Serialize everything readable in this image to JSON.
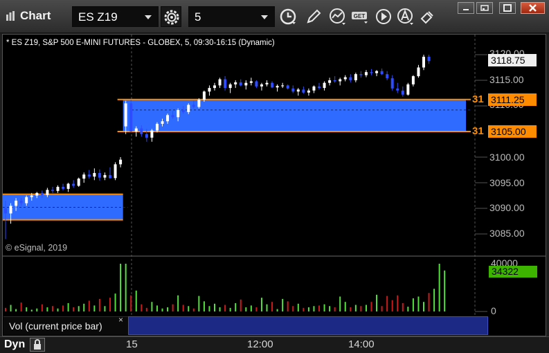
{
  "title_bar": {
    "title": "Chart",
    "symbol": "ES Z19",
    "interval": "5"
  },
  "icons": [
    "chart-app-icon",
    "settings-gear-icon",
    "clock-icon",
    "pencil-icon",
    "study-icon",
    "get-icon",
    "play-icon",
    "alert-icon",
    "cursor-icon",
    "minimize-icon",
    "restore-icon",
    "maximize-icon",
    "close-icon",
    "dropdown-caret-icon",
    "dynamic-lock-icon"
  ],
  "chart": {
    "subtitle": "* ES Z19, S&P 500 E-MINI FUTURES - GLOBEX, 5, 09:30-16:15 (Dynamic)",
    "copyright": "© eSignal, 2019",
    "price_labels": [
      "3120.00",
      "3115.00",
      "3110.00",
      "3100.00",
      "3095.00",
      "3090.00",
      "3085.00"
    ],
    "current_price": "3118.75",
    "level_high": "3111.25",
    "level_low": "3105.00",
    "level_tag": "31",
    "volume_labels": [
      "40000",
      "0"
    ],
    "current_volume": "34322",
    "volume_legend": "Vol (current price bar)",
    "legend_close": "×",
    "dyn_label": "Dyn",
    "time_labels": [
      "15",
      "12:00",
      "14:00"
    ]
  },
  "colors": {
    "up": "#ffffff",
    "down": "#2d4cff",
    "zone_fill": "#2f6bff",
    "zone_line": "#ff8c00",
    "vol_up": "#55e040",
    "vol_down": "#cc1a1a"
  },
  "chart_data": {
    "type": "candlestick",
    "symbol": "ES Z19",
    "y_range": [
      3082.5,
      3122.5
    ],
    "zones": [
      {
        "name": "prior-day-range",
        "low": 3087.75,
        "high": 3092.75,
        "x_start_bar": 0,
        "x_end_bar": 23
      },
      {
        "name": "today-range",
        "low": 3105.0,
        "high": 3111.25,
        "x_start_bar": 23,
        "x_end_bar": 84
      }
    ],
    "candles": [
      [
        3090.0,
        3091.5,
        3084.0,
        3089.0
      ],
      [
        3089.0,
        3091.0,
        3087.0,
        3090.5
      ],
      [
        3090.5,
        3092.0,
        3089.5,
        3091.5
      ],
      [
        3091.5,
        3092.0,
        3090.5,
        3091.0
      ],
      [
        3091.0,
        3092.5,
        3090.5,
        3092.2
      ],
      [
        3092.2,
        3093.0,
        3091.5,
        3092.5
      ],
      [
        3092.5,
        3093.2,
        3092.0,
        3093.0
      ],
      [
        3093.0,
        3093.5,
        3092.0,
        3092.6
      ],
      [
        3092.6,
        3094.0,
        3092.2,
        3093.6
      ],
      [
        3093.6,
        3094.2,
        3093.0,
        3093.4
      ],
      [
        3093.4,
        3094.5,
        3093.0,
        3094.2
      ],
      [
        3094.2,
        3094.8,
        3093.5,
        3093.8
      ],
      [
        3093.8,
        3095.0,
        3093.2,
        3094.8
      ],
      [
        3094.8,
        3095.5,
        3094.0,
        3094.4
      ],
      [
        3094.4,
        3096.0,
        3094.2,
        3095.8
      ],
      [
        3095.8,
        3097.0,
        3095.0,
        3096.6
      ],
      [
        3096.6,
        3097.5,
        3095.8,
        3096.2
      ],
      [
        3096.2,
        3097.8,
        3095.5,
        3096.9
      ],
      [
        3096.9,
        3097.6,
        3095.4,
        3096.0
      ],
      [
        3096.0,
        3097.0,
        3095.5,
        3096.5
      ],
      [
        3096.5,
        3098.0,
        3095.8,
        3095.9
      ],
      [
        3095.9,
        3099.0,
        3095.5,
        3098.6
      ],
      [
        3098.6,
        3100.0,
        3098.0,
        3099.5
      ],
      [
        3106.0,
        3111.0,
        3104.5,
        3110.5
      ],
      [
        3110.5,
        3111.2,
        3104.8,
        3105.0
      ],
      [
        3105.0,
        3106.0,
        3104.0,
        3105.6
      ],
      [
        3105.6,
        3106.2,
        3104.0,
        3104.5
      ],
      [
        3104.5,
        3105.5,
        3103.0,
        3103.8
      ],
      [
        3103.8,
        3105.5,
        3103.0,
        3105.2
      ],
      [
        3105.2,
        3106.8,
        3104.8,
        3106.5
      ],
      [
        3106.5,
        3107.5,
        3106.0,
        3107.0
      ],
      [
        3107.0,
        3108.5,
        3106.5,
        3108.2
      ],
      [
        3108.2,
        3109.0,
        3107.5,
        3107.8
      ],
      [
        3107.8,
        3109.5,
        3107.0,
        3109.2
      ],
      [
        3109.2,
        3110.0,
        3108.5,
        3108.8
      ],
      [
        3108.8,
        3110.5,
        3108.4,
        3110.2
      ],
      [
        3110.2,
        3111.0,
        3109.5,
        3109.8
      ],
      [
        3109.8,
        3111.5,
        3109.5,
        3111.2
      ],
      [
        3111.2,
        3113.0,
        3110.8,
        3112.8
      ],
      [
        3112.8,
        3114.0,
        3112.0,
        3113.5
      ],
      [
        3113.5,
        3114.5,
        3113.0,
        3114.0
      ],
      [
        3114.0,
        3115.5,
        3113.5,
        3115.2
      ],
      [
        3115.2,
        3115.8,
        3113.0,
        3113.5
      ],
      [
        3113.5,
        3114.5,
        3112.5,
        3114.2
      ],
      [
        3114.2,
        3115.0,
        3113.5,
        3114.6
      ],
      [
        3114.6,
        3115.2,
        3113.8,
        3114.0
      ],
      [
        3114.0,
        3115.0,
        3113.2,
        3114.5
      ],
      [
        3114.5,
        3115.5,
        3114.0,
        3114.8
      ],
      [
        3114.8,
        3115.0,
        3113.5,
        3113.8
      ],
      [
        3113.8,
        3114.5,
        3113.0,
        3114.2
      ],
      [
        3114.2,
        3115.0,
        3113.8,
        3114.5
      ],
      [
        3114.5,
        3114.8,
        3113.5,
        3113.6
      ],
      [
        3113.6,
        3114.2,
        3112.8,
        3113.9
      ],
      [
        3113.9,
        3114.5,
        3113.5,
        3114.0
      ],
      [
        3114.0,
        3114.2,
        3113.2,
        3113.4
      ],
      [
        3113.4,
        3114.0,
        3112.5,
        3112.8
      ],
      [
        3112.8,
        3113.5,
        3112.0,
        3113.2
      ],
      [
        3113.2,
        3113.8,
        3112.4,
        3112.6
      ],
      [
        3112.6,
        3113.4,
        3112.0,
        3113.0
      ],
      [
        3113.0,
        3114.0,
        3112.5,
        3113.8
      ],
      [
        3113.8,
        3114.5,
        3113.2,
        3113.5
      ],
      [
        3113.5,
        3114.8,
        3113.0,
        3114.5
      ],
      [
        3114.5,
        3115.5,
        3114.0,
        3115.0
      ],
      [
        3115.0,
        3115.8,
        3114.5,
        3114.8
      ],
      [
        3114.8,
        3115.5,
        3114.0,
        3115.2
      ],
      [
        3115.2,
        3116.0,
        3114.8,
        3115.6
      ],
      [
        3115.6,
        3116.2,
        3114.6,
        3115.0
      ],
      [
        3115.0,
        3116.5,
        3114.6,
        3116.2
      ],
      [
        3116.2,
        3116.8,
        3115.5,
        3116.0
      ],
      [
        3116.0,
        3117.0,
        3115.6,
        3116.6
      ],
      [
        3116.6,
        3117.2,
        3116.0,
        3116.4
      ],
      [
        3116.4,
        3117.0,
        3115.8,
        3116.8
      ],
      [
        3116.8,
        3117.3,
        3116.0,
        3116.2
      ],
      [
        3116.2,
        3116.8,
        3115.0,
        3115.4
      ],
      [
        3115.4,
        3116.0,
        3113.0,
        3113.4
      ],
      [
        3113.4,
        3114.5,
        3112.5,
        3113.0
      ],
      [
        3113.0,
        3113.8,
        3111.8,
        3112.2
      ],
      [
        3112.2,
        3114.5,
        3112.0,
        3114.2
      ],
      [
        3114.2,
        3116.0,
        3113.8,
        3115.8
      ],
      [
        3115.8,
        3118.0,
        3115.5,
        3117.5
      ],
      [
        3117.5,
        3120.0,
        3117.0,
        3119.6
      ],
      [
        3119.6,
        3120.0,
        3118.2,
        3118.75
      ]
    ],
    "volume_range": [
      0,
      40000
    ],
    "volume": [
      3000,
      5500,
      2000,
      7500,
      3500,
      1500,
      2500,
      6000,
      3500,
      4500,
      2500,
      5000,
      7000,
      3500,
      4500,
      6500,
      9000,
      5000,
      10500,
      4500,
      11500,
      15000,
      40000,
      40000,
      13500,
      17500,
      6000,
      3000,
      8000,
      5000,
      2500,
      3500,
      6000,
      13500,
      5500,
      4500,
      2500,
      13000,
      8500,
      4500,
      6500,
      3500,
      5500,
      3000,
      7000,
      10000,
      3500,
      5000,
      3500,
      11500,
      6000,
      8000,
      2000,
      10500,
      8500,
      4500,
      6500,
      3000,
      3500,
      4500,
      5000,
      6000,
      4500,
      3500,
      12500,
      8000,
      3500,
      5500,
      4500,
      5500,
      8000,
      14000,
      4500,
      13000,
      9500,
      13500,
      7000,
      4000,
      11000,
      12500,
      8000,
      15500,
      19000,
      40000,
      34322
    ],
    "x_ticks": [
      {
        "label": "15",
        "bar": 23
      },
      {
        "label": "12:00",
        "bar": 43
      },
      {
        "label": "14:00",
        "bar": 62
      }
    ]
  }
}
